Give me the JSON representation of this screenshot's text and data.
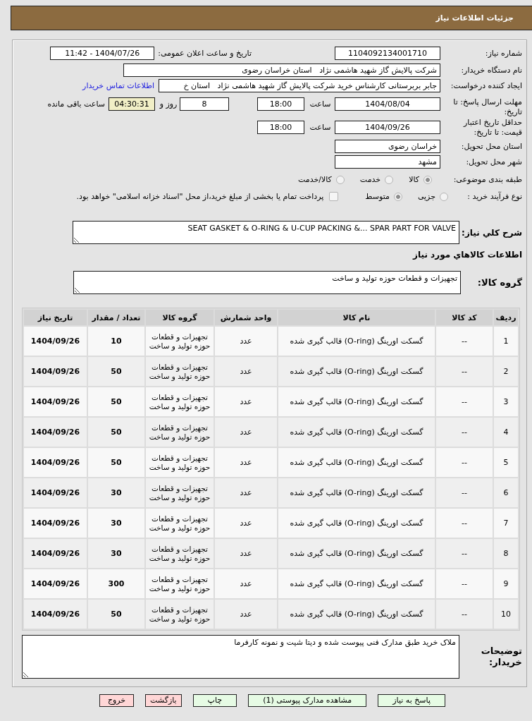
{
  "header": {
    "title": "جزئیات اطلاعات نیاز"
  },
  "details": {
    "need_number": {
      "label": "شماره نیاز:",
      "value": "1104092134001710"
    },
    "announce_datetime": {
      "label": "تاریخ و ساعت اعلان عمومی:",
      "value": "1404/07/26 - 11:42"
    },
    "buyer_org": {
      "label": "نام دستگاه خریدار:",
      "value": "شرکت پالایش گاز شهید هاشمی نژاد   استان خراسان رضوی"
    },
    "requester": {
      "label": "ایجاد کننده درخواست:",
      "value": "جابر بربرستانی کارشناس خرید شرکت پالایش گاز شهید هاشمی نژاد   استان خ",
      "contact_link": "اطلاعات تماس خریدار"
    },
    "response_deadline": {
      "label": "مهلت ارسال پاسخ: تا تاریخ:",
      "date": "1404/08/04",
      "time_label": "ساعت",
      "time": "18:00",
      "days": "8",
      "days_label": "روز و",
      "remaining": "04:30:31",
      "remaining_label": "ساعت باقی مانده"
    },
    "price_validity": {
      "label": "حداقل تاریخ اعتبار قیمت: تا تاریخ:",
      "date": "1404/09/26",
      "time_label": "ساعت",
      "time": "18:00"
    },
    "delivery_province": {
      "label": "استان محل تحویل:",
      "value": "خراسان رضوی"
    },
    "delivery_city": {
      "label": "شهر محل تحویل:",
      "value": "مشهد"
    },
    "category": {
      "label": "طبقه بندی موضوعی:",
      "options": [
        {
          "label": "کالا",
          "selected": true
        },
        {
          "label": "خدمت",
          "selected": false
        },
        {
          "label": "کالا/خدمت",
          "selected": false
        }
      ]
    },
    "purchase_process": {
      "label": "نوع فرآیند خرید :",
      "options": [
        {
          "label": "جزیی",
          "selected": false
        },
        {
          "label": "متوسط",
          "selected": true
        }
      ],
      "treasury_payment": {
        "label": "پرداخت تمام یا بخشی از مبلغ خرید،از محل \"اسناد خزانه اسلامی\" خواهد بود.",
        "checked": false
      }
    }
  },
  "description": {
    "label": "شرح کلي نياز:",
    "value": "SEAT GASKET & O-RING & U-CUP PACKING &... SPAR PART FOR VALVE"
  },
  "goods_heading": "اطلاعات كالاهاي مورد نياز",
  "goods_group": {
    "label": "گروه کالا:",
    "value": "تجهیزات و قطعات حوزه تولید و ساخت"
  },
  "table": {
    "columns": [
      "ردیف",
      "کد کالا",
      "نام کالا",
      "واحد شمارش",
      "گروه کالا",
      "تعداد / مقدار",
      "تاریخ نیاز"
    ],
    "rows": [
      [
        "1",
        "--",
        "گسکت اورینگ (O-ring) قالب گیری شده",
        "عدد",
        "تجهیزات و قطعات حوزه تولید و ساخت",
        "10",
        "1404/09/26"
      ],
      [
        "2",
        "--",
        "گسکت اورینگ (O-ring) قالب گیری شده",
        "عدد",
        "تجهیزات و قطعات حوزه تولید و ساخت",
        "50",
        "1404/09/26"
      ],
      [
        "3",
        "--",
        "گسکت اورینگ (O-ring) قالب گیری شده",
        "عدد",
        "تجهیزات و قطعات حوزه تولید و ساخت",
        "50",
        "1404/09/26"
      ],
      [
        "4",
        "--",
        "گسکت اورینگ (O-ring) قالب گیری شده",
        "عدد",
        "تجهیزات و قطعات حوزه تولید و ساخت",
        "50",
        "1404/09/26"
      ],
      [
        "5",
        "--",
        "گسکت اورینگ (O-ring) قالب گیری شده",
        "عدد",
        "تجهیزات و قطعات حوزه تولید و ساخت",
        "50",
        "1404/09/26"
      ],
      [
        "6",
        "--",
        "گسکت اورینگ (O-ring) قالب گیری شده",
        "عدد",
        "تجهیزات و قطعات حوزه تولید و ساخت",
        "30",
        "1404/09/26"
      ],
      [
        "7",
        "--",
        "گسکت اورینگ (O-ring) قالب گیری شده",
        "عدد",
        "تجهیزات و قطعات حوزه تولید و ساخت",
        "30",
        "1404/09/26"
      ],
      [
        "8",
        "--",
        "گسکت اورینگ (O-ring) قالب گیری شده",
        "عدد",
        "تجهیزات و قطعات حوزه تولید و ساخت",
        "30",
        "1404/09/26"
      ],
      [
        "9",
        "--",
        "گسکت اورینگ (O-ring) قالب گیری شده",
        "عدد",
        "تجهیزات و قطعات حوزه تولید و ساخت",
        "300",
        "1404/09/26"
      ],
      [
        "10",
        "--",
        "گسکت اورینگ (O-ring) قالب گیری شده",
        "عدد",
        "تجهیزات و قطعات حوزه تولید و ساخت",
        "50",
        "1404/09/26"
      ]
    ]
  },
  "buyer_notes": {
    "label": "توضیحات خریدار:",
    "value": "ملاک خرید طبق مدارک فنی پیوست شده و دیتا شیت و نمونه کارفرما"
  },
  "buttons": [
    {
      "label": "پاسخ به نیاز",
      "kind": "confirm"
    },
    {
      "label": "مشاهده مدارک پیوستی (1)",
      "kind": "confirm"
    },
    {
      "label": "چاپ",
      "kind": "confirm"
    },
    {
      "label": "بازگشت",
      "kind": "cancel"
    },
    {
      "label": "خروج",
      "kind": "cancel"
    }
  ]
}
